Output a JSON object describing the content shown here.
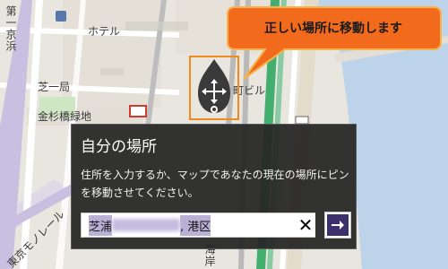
{
  "map": {
    "labels": {
      "hotel": "ホテル",
      "first_keihin": "第一京浜",
      "shiba_1": "芝一局",
      "kanasugibashi_ryokuchi": "金杉橋緑地",
      "tokyo_monorail": "東京モノレール",
      "kaigan": "海岸",
      "building": "町ビル"
    }
  },
  "callout": {
    "text": "正しい場所に移動します"
  },
  "panel": {
    "title": "自分の場所",
    "description": "住所を入力するか、マップであなたの現在の場所にピンを移動させてください。",
    "address_prefix": "芝浦",
    "address_suffix": ", 港区"
  },
  "colors": {
    "accent_orange": "#f08a1c",
    "callout_fill": "#f26b1d",
    "panel_bg": "#262626",
    "go_button": "#3b2f6e",
    "selection": "#b9b0d6",
    "water": "#bcd3ea",
    "rail_green": "#27a35a"
  },
  "icons": {
    "pin": "location-pin-icon",
    "move": "move-arrows-icon",
    "clear": "close-icon",
    "go": "arrow-right-icon"
  }
}
